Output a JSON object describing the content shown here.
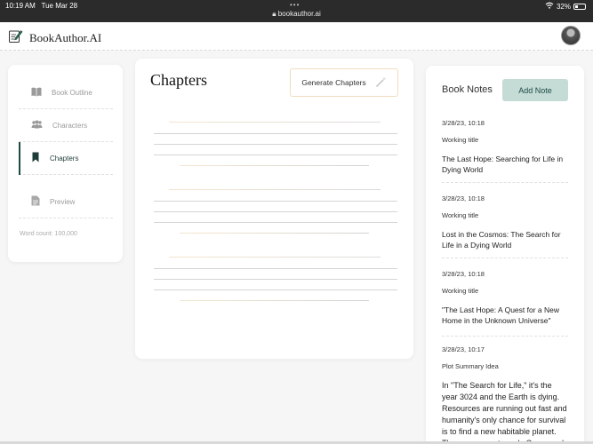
{
  "status_bar": {
    "time": "10:19 AM",
    "date": "Tue Mar 28",
    "dots": "•••",
    "url": "bookauthor.ai",
    "battery": "32%",
    "battery_level": 0.32
  },
  "app": {
    "title": "BookAuthor.AI",
    "logo_icon": "pencil-notepad-icon"
  },
  "nav": {
    "items": [
      {
        "label": "Book Outline",
        "icon": "book-open-icon",
        "active": false
      },
      {
        "label": "Characters",
        "icon": "people-icon",
        "active": false
      },
      {
        "label": "Chapters",
        "icon": "bookmark-icon",
        "active": true
      },
      {
        "label": "Preview",
        "icon": "document-icon",
        "active": false
      }
    ],
    "word_count": "Word count: 100,000"
  },
  "chapters": {
    "title": "Chapters",
    "generate_label": "Generate Chapters",
    "generate_icon": "magic-wand-icon"
  },
  "notes": {
    "title": "Book Notes",
    "add_label": "Add Note",
    "items": [
      {
        "timestamp": "3/28/23, 10:18",
        "kind": "Working title",
        "body": "The Last Hope: Searching for Life in Dying World"
      },
      {
        "timestamp": "3/28/23, 10:18",
        "kind": "Working title",
        "body": "Lost in the Cosmos: The Search for Life in a Dying World"
      },
      {
        "timestamp": "3/28/23, 10:18",
        "kind": "Working title",
        "body": "\"The Last Hope: A Quest for a New Home in the Unknown Universe\""
      },
      {
        "timestamp": "3/28/23, 10:17",
        "kind": "Plot Summary Idea",
        "body": "In \"The Search for Life,\" it's the year 3024 and the Earth is dying. Resources are running out fast and humanity's only chance for survival is to find a new habitable planet. The government sends Goran and Mala"
      }
    ]
  },
  "colors": {
    "accent": "#1e4a45",
    "add_note_bg": "#c5dcd6",
    "generate_border": "#f2dcc0"
  }
}
